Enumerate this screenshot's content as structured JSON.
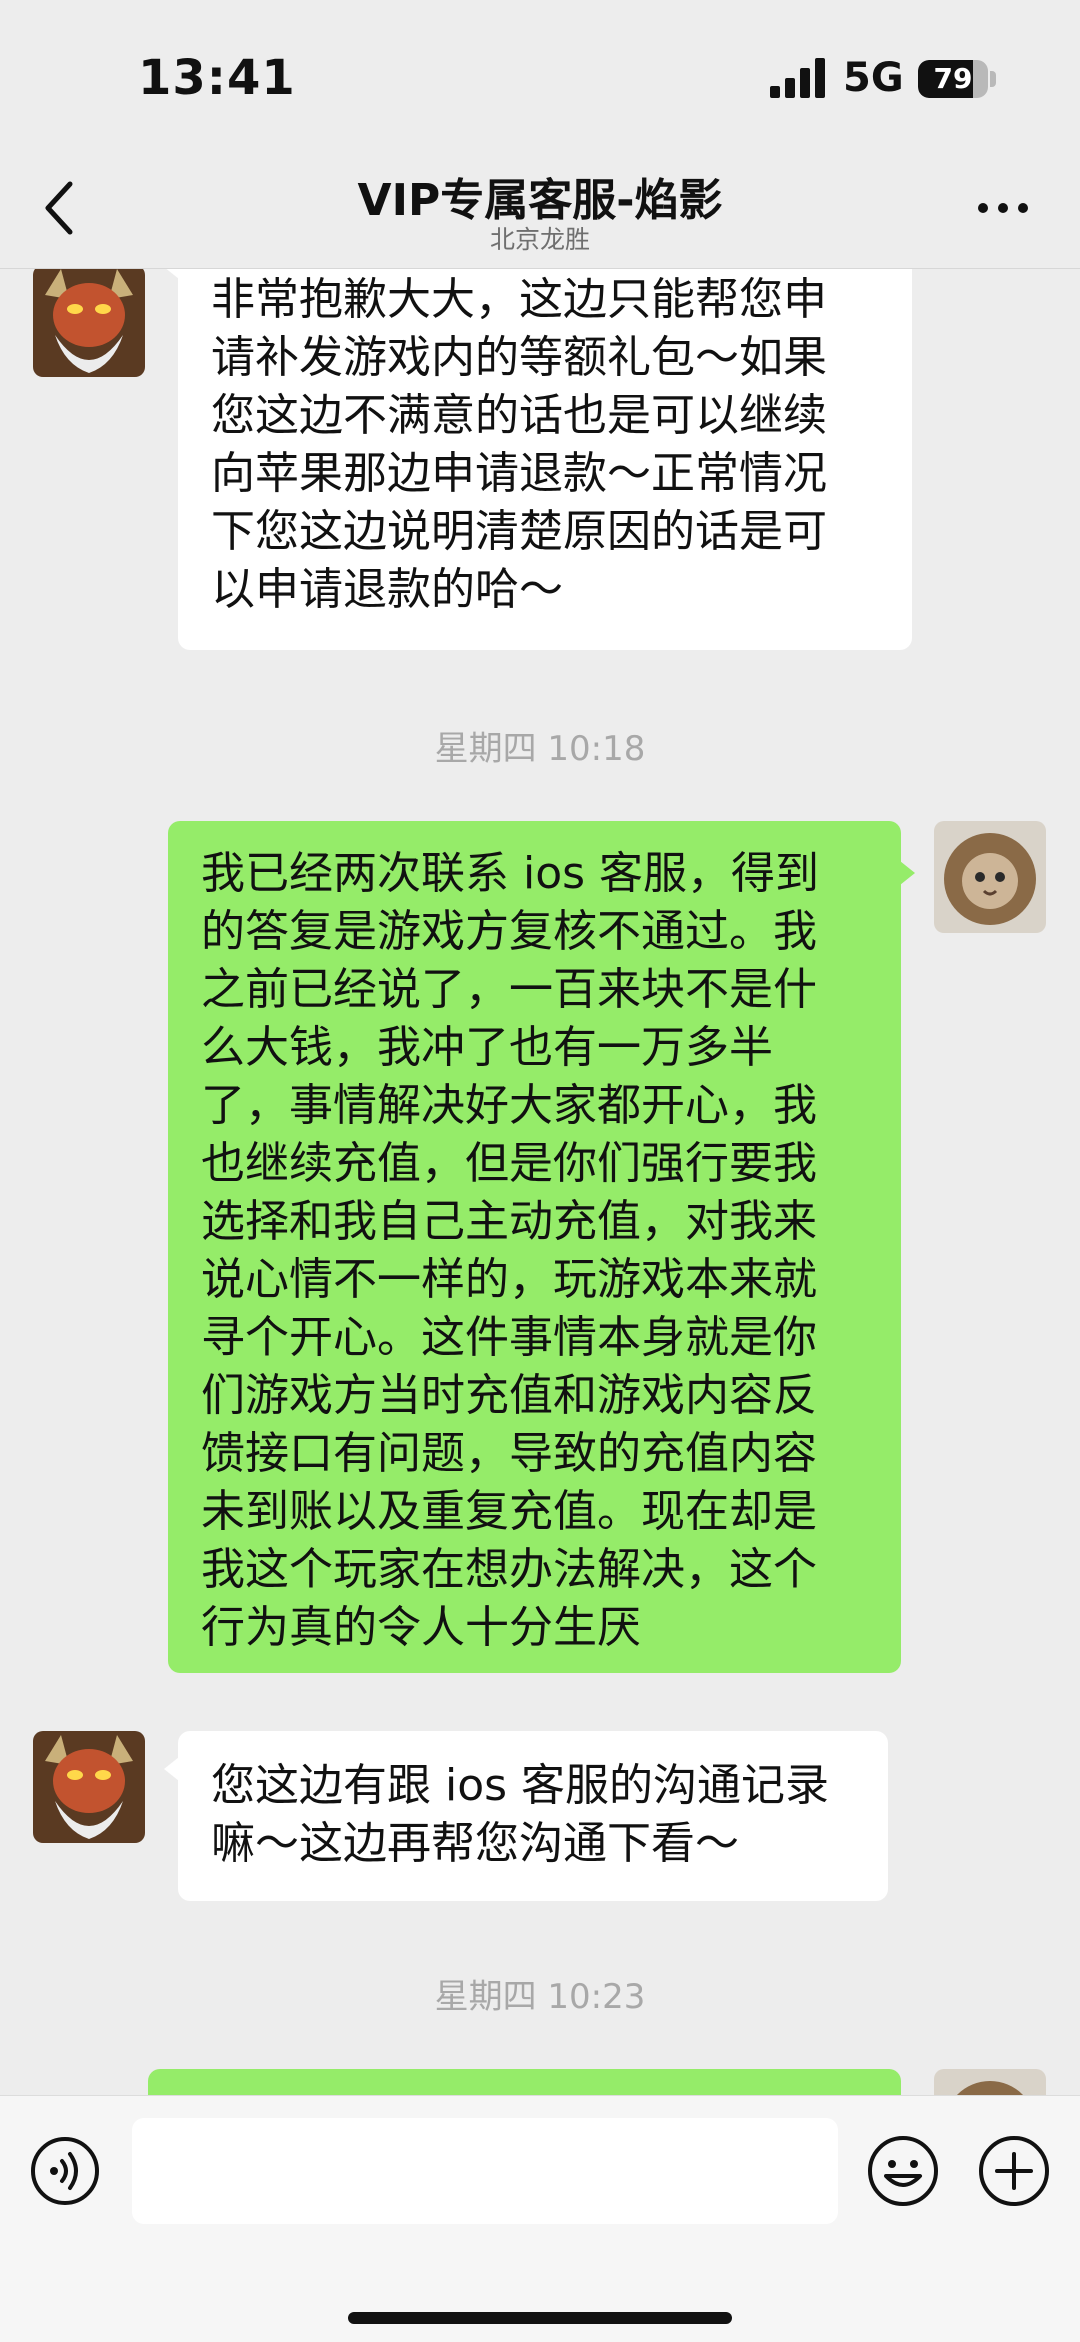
{
  "status_bar": {
    "time": "13:41",
    "network": "5G",
    "battery_level": "79",
    "battery_fraction": 0.79
  },
  "header": {
    "title": "VIP专属客服-焰影",
    "subtitle": "北京龙胜"
  },
  "messages": [
    {
      "type": "incoming",
      "avatar": "warrior-avatar",
      "lines": [
        "非常抱歉大大，这边只能帮您申",
        "请补发游戏内的等额礼包～如果",
        "您这边不满意的话也是可以继续",
        "向苹果那边申请退款～正常情况",
        "下您这边说明清楚原因的话是可",
        "以申请退款的哈～"
      ]
    },
    {
      "type": "timestamp",
      "text": "星期四 10:18"
    },
    {
      "type": "outgoing",
      "avatar": "lion-cat-avatar",
      "lines": [
        "我已经两次联系 ios 客服，得到",
        "的答复是游戏方复核不通过。我",
        "之前已经说了，一百来块不是什",
        "么大钱，我冲了也有一万多半",
        "了，事情解决好大家都开心，我",
        "也继续充值，但是你们强行要我",
        "选择和我自己主动充值，对我来",
        "说心情不一样的，玩游戏本来就",
        "寻个开心。这件事情本身就是你",
        "们游戏方当时充值和游戏内容反",
        "馈接口有问题，导致的充值内容",
        "未到账以及重复充值。现在却是",
        "我这个玩家在想办法解决，这个",
        "行为真的令人十分生厌"
      ]
    },
    {
      "type": "incoming",
      "avatar": "warrior-avatar",
      "lines": [
        "您这边有跟 ios 客服的沟通记录",
        "嘛～这边再帮您沟通下看～"
      ]
    },
    {
      "type": "timestamp",
      "text": "星期四 10:23"
    }
  ],
  "input": {
    "placeholder": "",
    "value": ""
  },
  "colors": {
    "outgoing_bubble": "#95ec69",
    "incoming_bubble": "#ffffff",
    "background": "#ededed"
  },
  "icons": [
    "back-arrow-icon",
    "more-icon",
    "voice-icon",
    "emoji-icon",
    "add-icon"
  ]
}
